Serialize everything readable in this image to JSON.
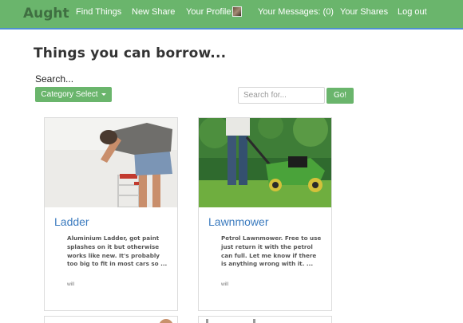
{
  "nav": {
    "brand": "Aught",
    "links": [
      "Find Things",
      "New Share",
      "Your Profile:",
      "Your Messages: (0)",
      "Your Shares",
      "Log out"
    ]
  },
  "page": {
    "title": "Things you can borrow...",
    "search_label": "Search...",
    "category_button": "Category Select",
    "search_placeholder": "Search for...",
    "go_button": "Go!"
  },
  "cards": [
    {
      "title": "Ladder",
      "description": "Aluminium Ladder, got paint splashes on it but otherwise works like new. It's probably too big to fit in most cars so ...",
      "owner": "will"
    },
    {
      "title": "Lawnmower",
      "description": "Petrol Lawnmower. Free to use just return it with the petrol can full. Let me know if there is anything wrong with it. ...",
      "owner": "will"
    }
  ],
  "colors": {
    "navbar": "#6ab56c",
    "brand_text": "#3f6f41",
    "link_title": "#3b7bbf",
    "button": "#6ab56c"
  }
}
